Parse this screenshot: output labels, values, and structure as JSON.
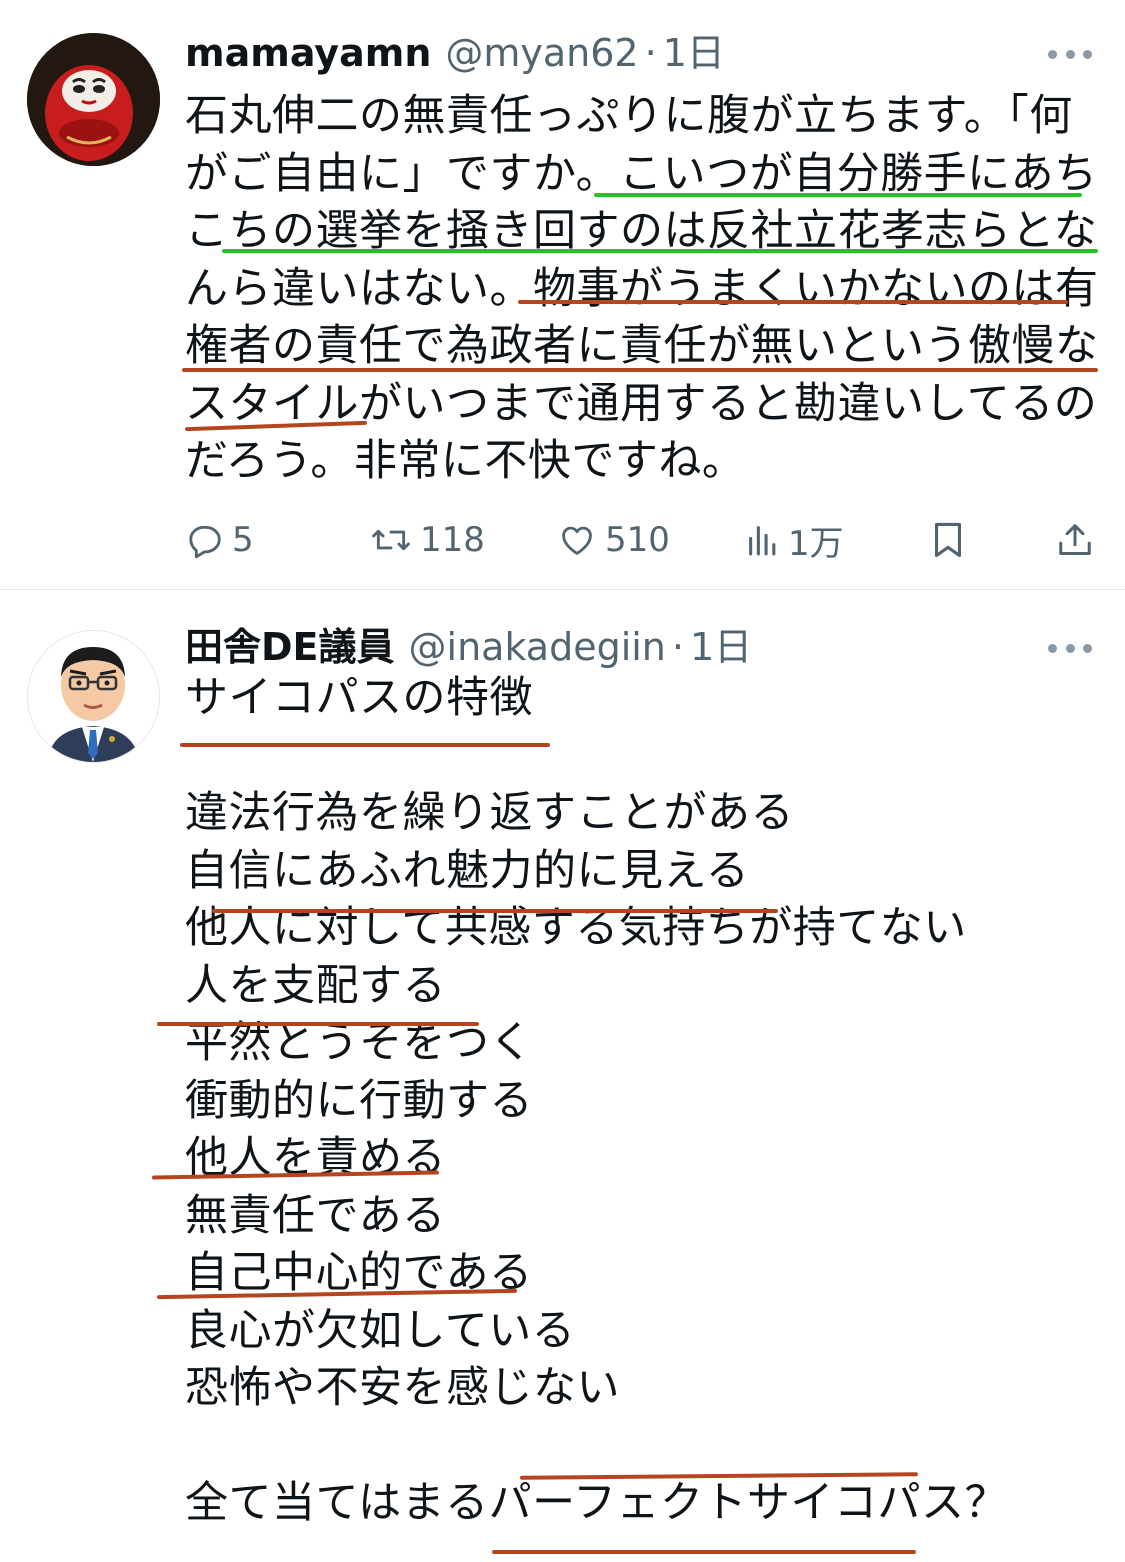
{
  "tweets": [
    {
      "display_name": "mamayamn",
      "handle": "@myan62",
      "separator": "·",
      "time": "1日",
      "lines": [
        "石丸伸二の無責任っぷりに腹が立ちます。「何",
        "がご自由に」ですか。こいつが自分勝手にあち",
        "こちの選挙を掻き回すのは反社立花孝志らとな",
        "んら違いはない。物事がうまくいかないのは有",
        "権者の責任で為政者に責任が無いという傲慢な",
        "スタイルがいつまで通用すると勘違いしてるの",
        "だろう。非常に不快ですね。"
      ],
      "actions": {
        "reply": "5",
        "retweet": "118",
        "like": "510",
        "views": "1万"
      }
    },
    {
      "display_name": "田舎DE議員",
      "handle": "@inakadegiin",
      "separator": "·",
      "time": "1日",
      "title": "サイコパスの特徴",
      "items": [
        "違法行為を繰り返すことがある",
        "自信にあふれ魅力的に見える",
        "他人に対して共感する気持ちが持てない",
        "人を支配する",
        "平然とうそをつく",
        "衝動的に行動する",
        "他人を責める",
        "無責任である",
        "自己中心的である",
        "良心が欠如している",
        "恐怖や不安を感じない"
      ],
      "closing": "全て当てはまるパーフェクトサイコパス？"
    }
  ],
  "icons": {
    "more": "more-icon",
    "reply": "reply-icon",
    "retweet": "retweet-icon",
    "like": "heart-icon",
    "views": "views-icon",
    "bookmark": "bookmark-icon",
    "share": "share-icon"
  },
  "colors": {
    "text": "#0f1419",
    "secondary": "#536471",
    "green_underline": "#22c322",
    "red_underline": "#b5451f"
  }
}
